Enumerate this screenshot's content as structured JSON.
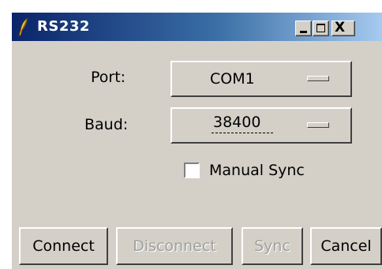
{
  "window": {
    "title": "RS232",
    "icon": "feather-icon",
    "caption_buttons": {
      "minimize": "minimize-icon",
      "maximize": "maximize-icon",
      "close_glyph": "X"
    }
  },
  "form": {
    "port": {
      "label": "Port:",
      "value": "COM1"
    },
    "baud": {
      "label": "Baud:",
      "value": "38400"
    },
    "manual_sync": {
      "label": "Manual Sync",
      "checked": false
    }
  },
  "buttons": {
    "connect": {
      "label": "Connect",
      "enabled": true
    },
    "disconnect": {
      "label": "Disconnect",
      "enabled": false
    },
    "sync": {
      "label": "Sync",
      "enabled": false
    },
    "cancel": {
      "label": "Cancel",
      "enabled": true
    }
  },
  "colors": {
    "face": "#d4d0c8",
    "title_start": "#0a246a",
    "title_end": "#a6caf0",
    "disabled_text": "#a0a0a0"
  }
}
